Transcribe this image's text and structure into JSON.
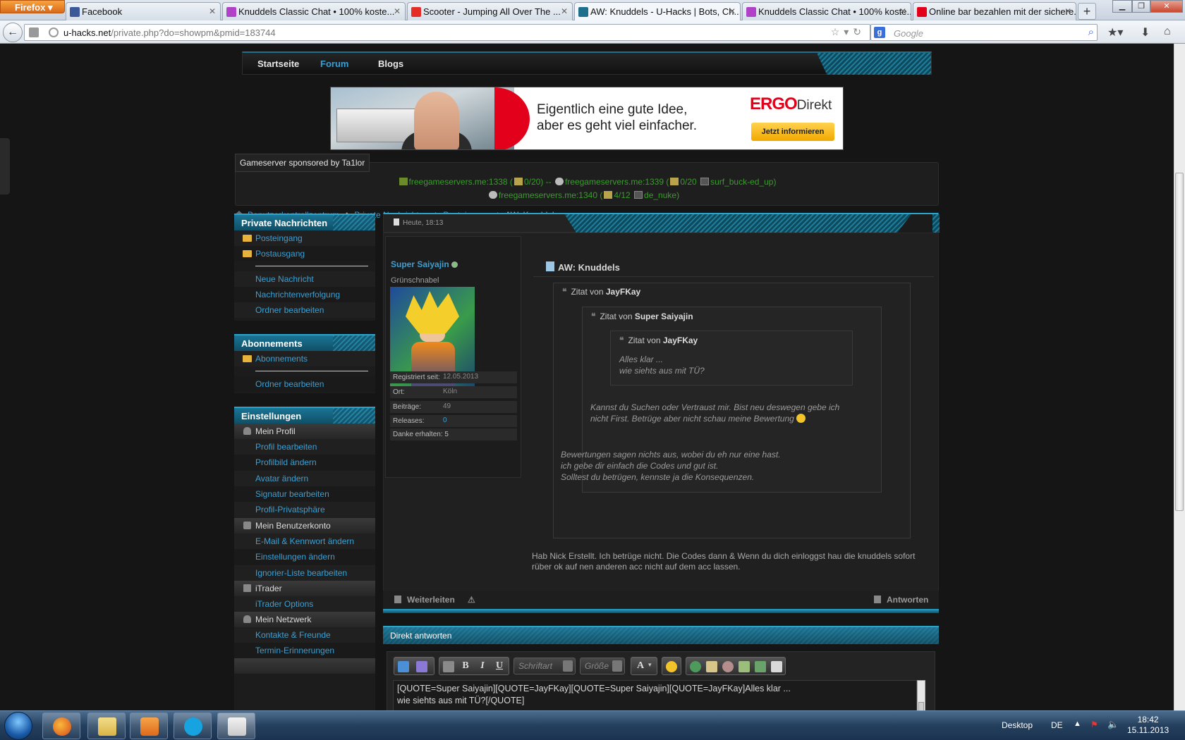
{
  "browser": {
    "app_button": "Firefox",
    "tabs": [
      {
        "title": "Facebook",
        "icon_color": "#3b5998"
      },
      {
        "title": "Knuddels Classic Chat • 100% koste...",
        "icon_color": "#b042c8"
      },
      {
        "title": "Scooter - Jumping All Over The ...",
        "icon_color": "#e52d27"
      },
      {
        "title": "AW: Knuddels - U-Hacks | Bots, Ch...",
        "icon_color": "#1d6f8c"
      },
      {
        "title": "Knuddels Classic Chat • 100% koste...",
        "icon_color": "#b042c8"
      },
      {
        "title": "Online bar bezahlen mit der sichere...",
        "icon_color": "#e2001a"
      }
    ],
    "new_tab": "+",
    "url_host": "u-hacks.net",
    "url_path": "/private.php?do=showpm&pmid=183744",
    "search_placeholder": "Google"
  },
  "site": {
    "nav": [
      "Startseite",
      "Forum",
      "Blogs"
    ],
    "banner": {
      "headline_1": "Eigentlich eine gute Idee,",
      "headline_2": "aber es geht viel einfacher.",
      "logo": "ERGO",
      "logo_suffix": "Direkt",
      "cta": "Jetzt informieren"
    },
    "gameserver": {
      "title": "Gameserver sponsored by Ta1lor",
      "line1_a": "freegameservers.me:1338 (",
      "line1_b": "0/20) -- ",
      "line1_c": "freegameservers.me:1339 (",
      "line1_d": "0/20 ",
      "line1_e": "surf_buck-ed_up)",
      "line2_a": "freegameservers.me:1340 (",
      "line2_b": "4/12 ",
      "line2_c": "de_nuke)"
    },
    "breadcrumb": [
      "Benutzerkontrollzentrum",
      "Private Nachrichten",
      "Posteingang",
      "AW: Knuddels"
    ]
  },
  "sidebar": {
    "pm_title": "Private Nachrichten",
    "pm_items": [
      "Posteingang",
      "Postausgang"
    ],
    "pm_links": [
      "Neue Nachricht",
      "Nachrichtenverfolgung",
      "Ordner bearbeiten"
    ],
    "abo_title": "Abonnements",
    "abo_item": "Abonnements",
    "abo_link": "Ordner bearbeiten",
    "settings_title": "Einstellungen",
    "sec_profile": "Mein Profil",
    "profile_links": [
      "Profil bearbeiten",
      "Profilbild ändern",
      "Avatar ändern",
      "Signatur bearbeiten",
      "Profil-Privatsphäre"
    ],
    "sec_account": "Mein Benutzerkonto",
    "account_links": [
      "E-Mail & Kennwort ändern",
      "Einstellungen ändern",
      "Ignorier-Liste bearbeiten"
    ],
    "sec_itrader": "iTrader",
    "itrader_link": "iTrader Options",
    "sec_network": "Mein Netzwerk",
    "network_links": [
      "Kontakte & Freunde",
      "Termin-Erinnerungen"
    ]
  },
  "post": {
    "date": "Heute, 18:13",
    "username": "Super Saiyajin",
    "rank": "Grünschnabel",
    "stats": [
      {
        "label": "Registriert seit:",
        "value": "12.05.2013"
      },
      {
        "label": "Ort:",
        "value": "Köln"
      },
      {
        "label": "Beiträge:",
        "value": "49"
      },
      {
        "label": "Releases:",
        "value": "0"
      },
      {
        "label": "Danke erhalten: 5",
        "value": ""
      }
    ],
    "title": "AW: Knuddels",
    "quote_prefix": "Zitat von",
    "q1_author": "JayFKay",
    "q2_author": "Super Saiyajin",
    "q3_author": "JayFKay",
    "q3_text_1": "Alles klar ...",
    "q3_text_2": "wie siehts aus mit TÜ?",
    "q2_text_1": "Kannst du Suchen oder Vertraust mir. Bist neu deswegen gebe ich",
    "q2_text_2": "nicht First. Betrüge aber nicht schau meine Bewertung",
    "q1_text_1": "Bewertungen sagen nichts aus, wobei du eh nur eine hast.",
    "q1_text_2": "ich gebe dir einfach die Codes und gut ist.",
    "q1_text_3": "Solltest du betrügen, kennste ja die Konsequenzen.",
    "body_1": "Hab Nick Erstellt. Ich betrüge nicht. Die Codes dann & Wenn du dich einloggst hau die knuddels sofort",
    "body_2": "rüber ok auf nen anderen acc nicht auf dem acc lassen.",
    "forward": "Weiterleiten",
    "reply": "Antworten"
  },
  "quick_reply": {
    "title": "Direkt antworten",
    "font_select": "Schriftart",
    "size_select": "Größe",
    "editor_text": "[QUOTE=Super Saiyajin][QUOTE=JayFKay][QUOTE=Super Saiyajin][QUOTE=JayFKay]Alles klar ...\nwie siehts aus mit TÜ?[/QUOTE]\n\nKannst du Suchen oder Vertraust mir. Bist neu deswegen gebe ich nicht First. Betrüge aber nicht schau meine Bewertung\n:)[/QUOTE]"
  },
  "taskbar": {
    "desktop_label": "Desktop",
    "lang": "DE",
    "time": "18:42",
    "date": "15.11.2013"
  }
}
